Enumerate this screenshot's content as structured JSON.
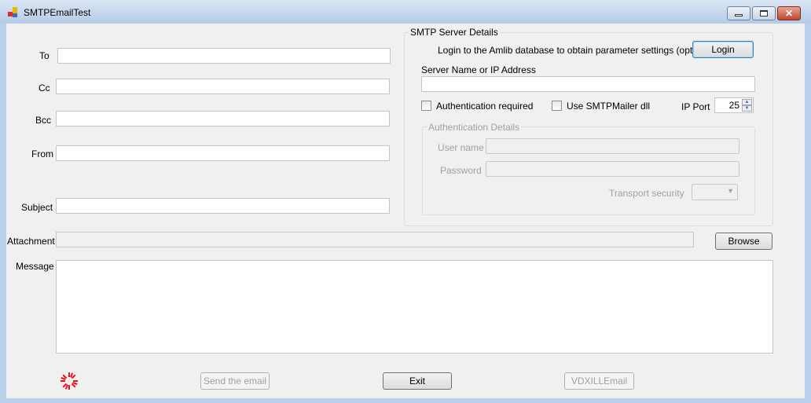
{
  "window": {
    "title": "SMTPEmailTest",
    "controls": [
      "minimize",
      "maximize",
      "close"
    ]
  },
  "form": {
    "to": {
      "label": "To",
      "value": ""
    },
    "cc": {
      "label": "Cc",
      "value": ""
    },
    "bcc": {
      "label": "Bcc",
      "value": ""
    },
    "from": {
      "label": "From",
      "value": ""
    },
    "subject": {
      "label": "Subject",
      "value": ""
    },
    "attachment": {
      "label": "Attachment",
      "value": ""
    },
    "message": {
      "label": "Message",
      "value": ""
    },
    "browse_label": "Browse"
  },
  "smtp": {
    "group_title": "SMTP Server Details",
    "login_text": "Login to the Amlib database to obtain parameter settings (optional)",
    "login_label": "Login",
    "server_label": "Server Name or IP Address",
    "server_value": "",
    "auth_required_label": "Authentication required",
    "auth_required_checked": false,
    "use_dll_label": "Use SMTPMailer dll",
    "use_dll_checked": false,
    "ip_port_label": "IP Port",
    "ip_port_value": "25",
    "auth": {
      "group_title": "Authentication Details",
      "username_label": "User name",
      "password_label": "Password",
      "transport_label": "Transport security",
      "transport_value": ""
    }
  },
  "footer": {
    "send_label": "Send the email",
    "exit_label": "Exit",
    "vdx_label": "VDXILLEmail"
  },
  "colors": {
    "spinner": "#e8121b",
    "accent": "#3c7fb1"
  }
}
